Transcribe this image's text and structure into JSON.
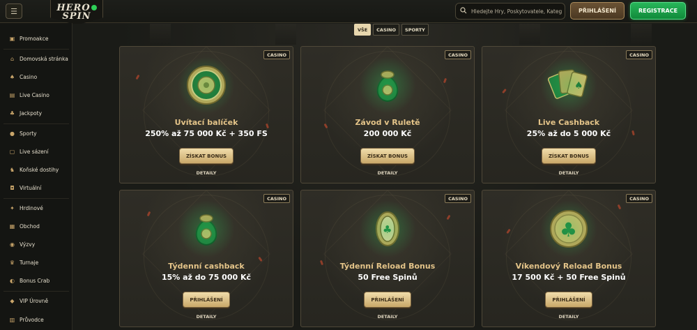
{
  "header": {
    "menu_icon": "menu-icon",
    "logo_line1": "HERO",
    "logo_line2": "SPIN",
    "search_placeholder": "Hledejte Hry, Poskytovatele, Katego...",
    "login_label": "PŘIHLÁŠENÍ",
    "register_label": "REGISTRACE",
    "colors": {
      "accent_green": "#28b65a",
      "gold": "#e4c489"
    }
  },
  "sidebar": {
    "items": [
      {
        "label": "Promoakce",
        "icon": "gift-icon"
      },
      {
        "label": "Domovská stránka",
        "icon": "home-icon"
      },
      {
        "label": "Casino",
        "icon": "casino-icon"
      },
      {
        "label": "Live Casino",
        "icon": "cards-icon"
      },
      {
        "label": "Jackpoty",
        "icon": "clover-icon"
      },
      {
        "label": "Sporty",
        "icon": "ball-icon"
      },
      {
        "label": "Live sázení",
        "icon": "live-icon"
      },
      {
        "label": "Koňské dostihy",
        "icon": "horse-icon"
      },
      {
        "label": "Virtuální",
        "icon": "gamepad-icon"
      },
      {
        "label": "Hrdinové",
        "icon": "hero-icon"
      },
      {
        "label": "Obchod",
        "icon": "shop-icon"
      },
      {
        "label": "Výzvy",
        "icon": "medal-icon"
      },
      {
        "label": "Turnaje",
        "icon": "trophy-icon"
      },
      {
        "label": "Bonus Crab",
        "icon": "crab-icon"
      },
      {
        "label": "VIP Úrovně",
        "icon": "diamond-icon"
      },
      {
        "label": "Průvodce",
        "icon": "book-icon"
      }
    ]
  },
  "filters": [
    {
      "label": "VŠE",
      "active": true
    },
    {
      "label": "CASINO",
      "active": false
    },
    {
      "label": "SPORTY",
      "active": false
    }
  ],
  "cards": [
    {
      "badge": "CASINO",
      "title": "Uvítací balíček",
      "subtitle": "250% až 75 000 Kč + 350 FS",
      "button": "ZÍSKAT BONUS",
      "details": "DETAILY",
      "art": "roulette-wheel-icon"
    },
    {
      "badge": "CASINO",
      "title": "Závod v Ruletě",
      "subtitle": "200 000 Kč",
      "button": "ZÍSKAT BONUS",
      "details": "DETAILY",
      "art": "money-bag-icon"
    },
    {
      "badge": "CASINO",
      "title": "Live Cashback",
      "subtitle": "25% až do 5 000 Kč",
      "button": "ZÍSKAT BONUS",
      "details": "DETAILY",
      "art": "playing-cards-icon"
    },
    {
      "badge": "CASINO",
      "title": "Týdenní cashback",
      "subtitle": "15% až do 75 000 Kč",
      "button": "PŘIHLÁŠENÍ",
      "details": "DETAILY",
      "art": "money-bag-icon"
    },
    {
      "badge": "CASINO",
      "title": "Týdenní Reload Bonus",
      "subtitle": "50 Free Spinů",
      "button": "PŘIHLÁŠENÍ",
      "details": "DETAILY",
      "art": "slot-reel-icon"
    },
    {
      "badge": "CASINO",
      "title": "Víkendový Reload Bonus",
      "subtitle": "17 500 Kč + 50 Free Spinů",
      "button": "PŘIHLÁŠENÍ",
      "details": "DETAILY",
      "art": "clover-coin-icon"
    }
  ]
}
